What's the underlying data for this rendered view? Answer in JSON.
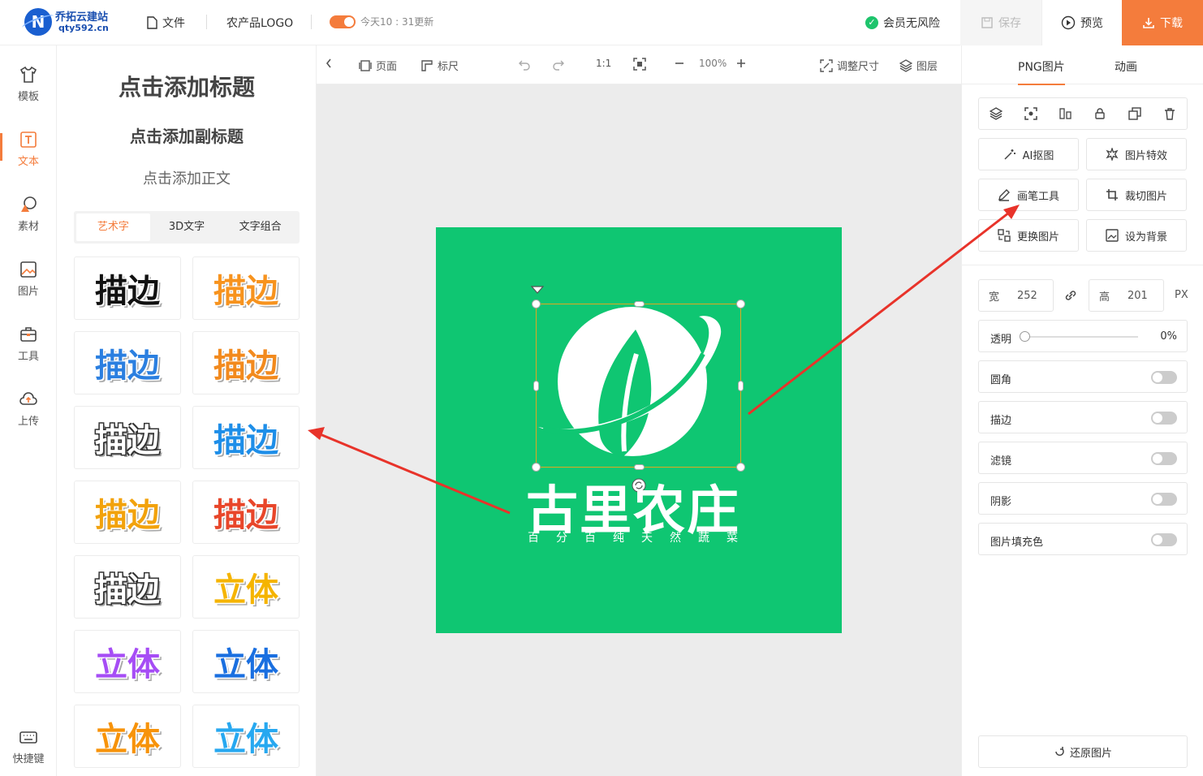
{
  "brand": {
    "name_cn": "乔拓云建站",
    "domain": "qty592.cn",
    "mark": "N"
  },
  "topbar": {
    "file_label": "文件",
    "project_name": "农产品LOGO",
    "autosave_text": "今天10 : 31更新",
    "member_text": "会员无风险",
    "save_label": "保存",
    "preview_label": "预览",
    "download_label": "下载"
  },
  "leftnav": [
    {
      "label": "模板",
      "icon": "tshirt-icon"
    },
    {
      "label": "文本",
      "icon": "text-icon"
    },
    {
      "label": "素材",
      "icon": "shapes-icon"
    },
    {
      "label": "图片",
      "icon": "image-icon"
    },
    {
      "label": "工具",
      "icon": "toolbox-icon"
    },
    {
      "label": "上传",
      "icon": "cloud-upload-icon"
    },
    {
      "label": "快捷键",
      "icon": "keyboard-icon"
    }
  ],
  "text_panel": {
    "add_title": "点击添加标题",
    "add_subtitle": "点击添加副标题",
    "add_body": "点击添加正文",
    "tabs": [
      "艺术字",
      "3D文字",
      "文字组合"
    ],
    "samples": [
      {
        "text": "描边",
        "color": "#111111"
      },
      {
        "text": "描边",
        "color": "#f7931e"
      },
      {
        "text": "描边",
        "color": "#2b7fe0"
      },
      {
        "text": "描边",
        "color": "#f28a1e"
      },
      {
        "text": "描边",
        "color": "#ffffff"
      },
      {
        "text": "描边",
        "color": "#1e8ee8"
      },
      {
        "text": "描边",
        "color": "#f2a20c"
      },
      {
        "text": "描边",
        "color": "#e8462a"
      },
      {
        "text": "描边",
        "color": "#ffffff"
      },
      {
        "text": "立体",
        "color": "#f5b400"
      },
      {
        "text": "立体",
        "color": "#a64df5"
      },
      {
        "text": "立体",
        "color": "#1a6fe0"
      },
      {
        "text": "立体",
        "color": "#f7930a"
      },
      {
        "text": "立体",
        "color": "#27a8f0"
      }
    ]
  },
  "canvas_toolbar": {
    "page_label": "页面",
    "ruler_label": "标尺",
    "ratio_label": "1:1",
    "zoom": "100%",
    "resize_label": "调整尺寸",
    "layers_label": "图层"
  },
  "artboard": {
    "background": "#0fc672",
    "brand_text": "古里农庄",
    "slogan": "百分百纯天然蔬菜"
  },
  "right_panel": {
    "tabs": [
      "PNG图片",
      "动画"
    ],
    "actions": [
      "AI抠图",
      "图片特效",
      "画笔工具",
      "裁切图片",
      "更换图片",
      "设为背景"
    ],
    "width_label": "宽",
    "width_value": "252",
    "height_label": "高",
    "height_value": "201",
    "unit": "PX",
    "opacity_label": "透明",
    "opacity_value": "0%",
    "toggles": [
      "圆角",
      "描边",
      "滤镜",
      "阴影",
      "图片填充色"
    ],
    "restore_label": "还原图片"
  },
  "colors": {
    "accent": "#f47c3c",
    "annotation_arrow": "#e8332a"
  }
}
